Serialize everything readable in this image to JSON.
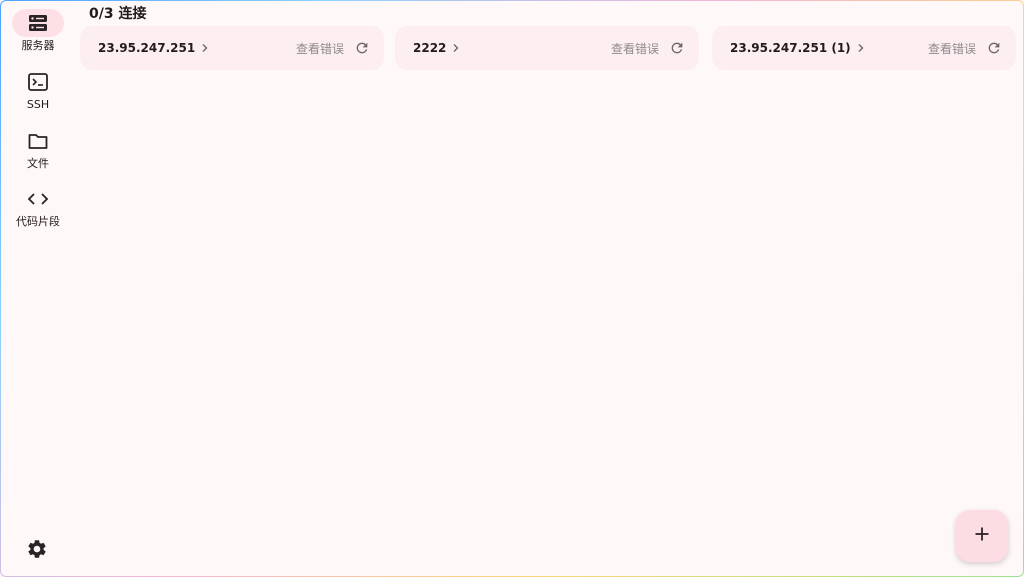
{
  "sidebar": {
    "items": [
      {
        "label": "服务器",
        "icon": "server-icon",
        "active": true
      },
      {
        "label": "SSH",
        "icon": "terminal-icon",
        "active": false
      },
      {
        "label": "文件",
        "icon": "folder-icon",
        "active": false
      },
      {
        "label": "代码片段",
        "icon": "code-icon",
        "active": false
      }
    ],
    "settings_icon": "gear-icon"
  },
  "header": {
    "connection_status": "0/3 连接"
  },
  "servers": [
    {
      "name": "23.95.247.251",
      "error_link": "查看错误"
    },
    {
      "name": "2222",
      "error_link": "查看错误"
    },
    {
      "name": "23.95.247.251 (1)",
      "error_link": "查看错误"
    }
  ],
  "fab": {
    "icon": "plus-icon"
  },
  "colors": {
    "accent": "#fde0e6",
    "card_bg": "#fdeef1",
    "background": "#fff8f8"
  }
}
